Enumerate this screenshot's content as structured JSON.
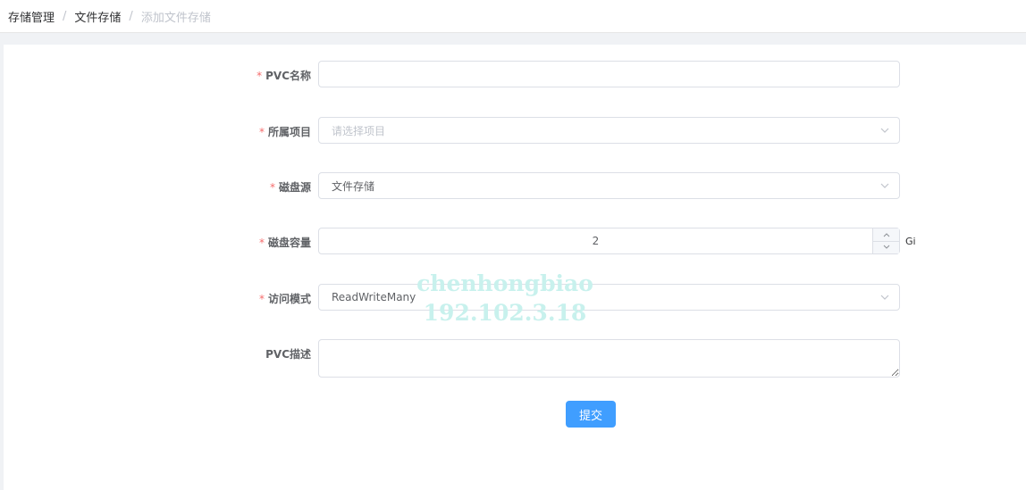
{
  "breadcrumb": [
    "存储管理",
    "文件存储",
    "添加文件存储"
  ],
  "form": {
    "pvc_name": {
      "label": "PVC名称",
      "value": ""
    },
    "project": {
      "label": "所属项目",
      "placeholder": "请选择项目"
    },
    "disk_source": {
      "label": "磁盘源",
      "value": "文件存储"
    },
    "capacity": {
      "label": "磁盘容量",
      "value": "2",
      "unit": "Gi"
    },
    "access_mode": {
      "label": "访问模式",
      "value": "ReadWriteMany"
    },
    "description": {
      "label": "PVC描述",
      "value": ""
    },
    "required_mark": "*",
    "submit_label": "提交"
  },
  "watermark": {
    "line1": "chenhongbiao",
    "line2": "192.102.3.18"
  },
  "colors": {
    "accent": "#409eff",
    "required": "#f56c6c",
    "watermark": "#c8f1ed"
  }
}
